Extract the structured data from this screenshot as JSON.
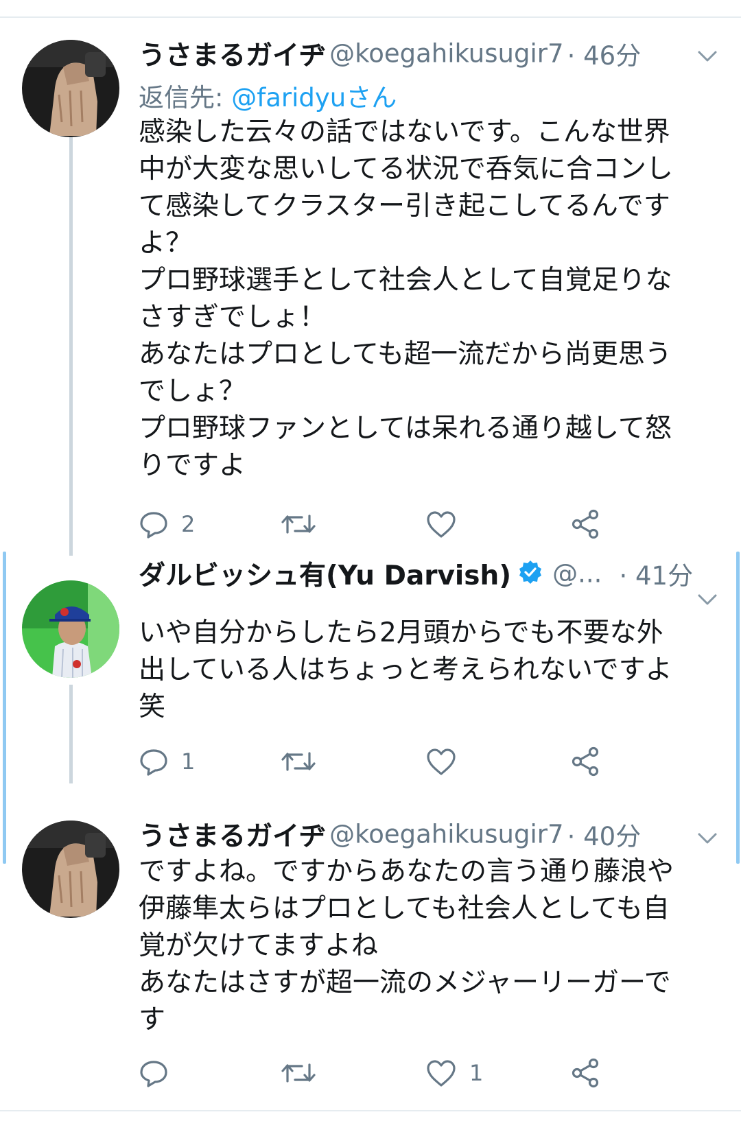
{
  "tweets": [
    {
      "name": "うさまるガイヂ",
      "handle": "@koegahikusugir7",
      "time": "· 46分",
      "reply_label": "返信先: ",
      "reply_mention": "@faridyuさん",
      "body_lines": [
        "感染した云々の話ではないです。こんな世界",
        "中が大変な思いしてる状況で呑気に合コンし",
        "て感染してクラスター引き起こしてるんです",
        "よ？",
        "プロ野球選手として社会人として自覚足りな",
        "さすぎでしょ！",
        "あなたはプロとしても超一流だから尚更思う",
        "でしょ？",
        "プロ野球ファンとしては呆れる通り越して怒",
        "りですよ"
      ],
      "reply_count": "2",
      "retweet_count": "",
      "like_count": ""
    },
    {
      "name": "ダルビッシュ有(Yu Darvish)",
      "handle": "@...",
      "time": "· 41分",
      "body_lines": [
        "いや自分からしたら2月頭からでも不要な外",
        "出している人はちょっと考えられないですよ",
        "笑"
      ],
      "reply_count": "1",
      "retweet_count": "",
      "like_count": ""
    },
    {
      "name": "うさまるガイヂ",
      "handle": "@koegahikusugir7",
      "time": "· 40分",
      "body_lines": [
        "ですよね。ですからあなたの言う通り藤浪や",
        "伊藤隼太らはプロとしても社会人としても自",
        "覚が欠けてますよね",
        "あなたはさすが超一流のメジャーリーガーで",
        "す"
      ],
      "reply_count": "",
      "retweet_count": "",
      "like_count": "1"
    }
  ],
  "icons": {
    "reply": "reply-icon",
    "retweet": "retweet-icon",
    "like": "heart-icon",
    "share": "share-icon",
    "more": "chevron-down-icon",
    "verified": "verified-badge-icon"
  },
  "colors": {
    "text": "#14171a",
    "secondary": "#657786",
    "link": "#1da1f2",
    "thread_line": "#ccd6dd",
    "highlight_bar": "#8fc9f2"
  }
}
